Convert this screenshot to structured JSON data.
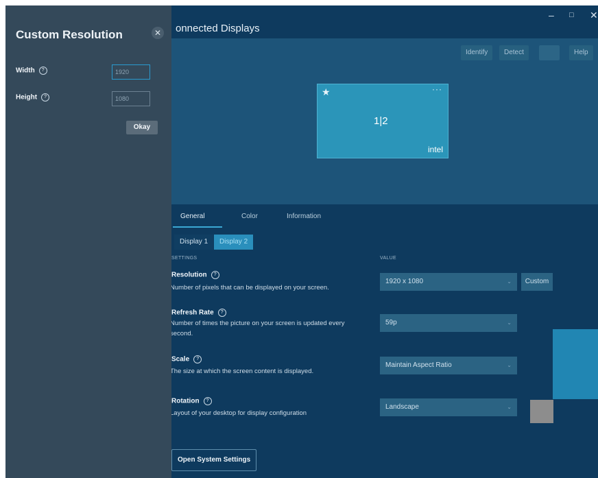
{
  "window": {
    "title": "onnected Displays",
    "controls": {
      "minimize": "–",
      "maximize": "□",
      "close": "✕"
    }
  },
  "toolbar": {
    "identify": "Identify",
    "detect": "Detect",
    "help": "Help"
  },
  "display_card": {
    "number": "1|2",
    "brand": "intel",
    "star": "★",
    "menu": "···"
  },
  "tabs": [
    {
      "label": "General",
      "active": true
    },
    {
      "label": "Color",
      "active": false
    },
    {
      "label": "Information",
      "active": false
    }
  ],
  "display_selector": [
    {
      "label": "Display 1",
      "selected": false
    },
    {
      "label": "Display 2",
      "selected": true
    }
  ],
  "columns": {
    "settings": "SETTINGS",
    "value": "VALUE"
  },
  "settings": {
    "resolution": {
      "title": "Resolution",
      "desc": "Number of pixels that can be displayed on your screen.",
      "value": "1920 x 1080",
      "custom": "Custom"
    },
    "refresh_rate": {
      "title": "Refresh Rate",
      "desc": "Number of times the picture on your screen is updated every second.",
      "value": "59p"
    },
    "scale": {
      "title": "Scale",
      "desc": "The size at which the screen content is displayed.",
      "value": "Maintain Aspect Ratio"
    },
    "rotation": {
      "title": "Rotation",
      "desc": "Layout of your desktop for display configuration",
      "value": "Landscape"
    }
  },
  "open_system_settings": "Open System Settings",
  "custom_panel": {
    "title": "Custom Resolution",
    "close": "✕",
    "width_label": "Width",
    "width_value": "1920",
    "height_label": "Height",
    "height_value": "1080",
    "okay": "Okay"
  },
  "help_glyph": "?",
  "chevron_glyph": "⌄",
  "colors": {
    "background": "#0e3a5e",
    "panel": "#34495a",
    "accent": "#2a8fbc",
    "card": "#2b95b9"
  }
}
